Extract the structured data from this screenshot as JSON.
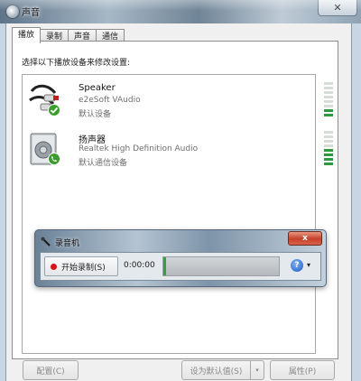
{
  "window": {
    "title": "声音",
    "close_label": "✕"
  },
  "tabs": [
    {
      "label": "播放",
      "active": true
    },
    {
      "label": "录制",
      "active": false
    },
    {
      "label": "声音",
      "active": false
    },
    {
      "label": "通信",
      "active": false
    }
  ],
  "panel": {
    "instruction": "选择以下播放设备来修改设置:"
  },
  "devices": [
    {
      "name": "Speaker",
      "driver": "e2eSoft VAudio",
      "status": "默认设备",
      "icon": "rca-cable-icon",
      "badge": "checkmark-badge-icon",
      "level_bars_lit": 2
    },
    {
      "name": "扬声器",
      "driver": "Realtek High Definition Audio",
      "status": "默认通信设备",
      "icon": "speaker-icon",
      "badge": "phone-badge-icon",
      "level_bars_lit": 4
    }
  ],
  "recorder": {
    "title": "录音机",
    "close_label": "x",
    "start_label": "开始录制(S)",
    "time": "0:00:00",
    "level_fraction": 0.02,
    "help_label": "?",
    "dropdown_label": "▾"
  },
  "buttons": {
    "configure": "配置(C)",
    "set_default": "设为默认值(S)",
    "set_default_arrow": "▾",
    "properties": "属性(P)"
  },
  "colors": {
    "meter_on": "#2e9a3d",
    "meter_off": "#d6dcd8",
    "record_dot": "#d7131a",
    "recorder_close": "#c5412a"
  }
}
